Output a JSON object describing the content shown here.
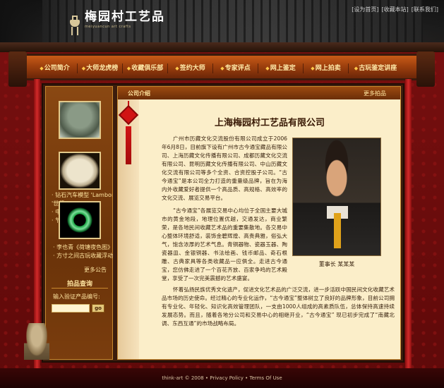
{
  "header": {
    "logo_text": "梅园村工艺品",
    "logo_subtitle": "meiyuancun art crafts",
    "top_links": [
      "[设为首页]",
      "[收藏本站]",
      "[联系我们]"
    ]
  },
  "nav": {
    "items": [
      "公司简介",
      "大师龙虎榜",
      "收藏俱乐部",
      "签约大师",
      "专家评点",
      "网上鉴定",
      "网上拍卖",
      "古玩鉴定讲座"
    ]
  },
  "sidebar": {
    "news_lines": [
      "· 钻石汽车模型 'Lamborghini Gallardo'",
      "'世纪...",
      "· 中...",
      "· 节..."
    ],
    "news_lines_2": [
      "· 李也青《荷塘夜色图》",
      "· 方寸之间古玩收藏浮动"
    ],
    "more": "更多公告",
    "auction_title": "拍品查询",
    "code_label": "输入验证产品编号:",
    "search_placeholder": "",
    "go_label": "go"
  },
  "main": {
    "section_title": "公司介绍",
    "more_link": "更多拍品",
    "company_name": "上海梅园村工艺品有限公司",
    "para1": "广州市历藏文化交流股份有限公司成立于2006年6月8日，目前旗下设有广州市古今通宝藏品有限公司、上海历藏文化传播有限公司、成都历藏文化交流有限公司、昆明历藏文化传播有限公司、中山历藏文化交流有限公司等多个全资、合资控股子公司。“古今通宝”是本公司全力打造的重量级品牌，旨在为海内外收藏爱好者提供一个高品质、高规格、高效率的文化交流、展览交易平台。",
    "para2": "“古今通宝”各展览交易中心均位于全国主要大城市的黄金地段，地理位置优越，交通发达，商业繁荣，是各地民间收藏艺术品的重要集散地。各交易中心整体环境舒适，装饰金碧辉煌、高贵典雅，俗弘大气，饱含浓厚的艺术气息。青铜器物、瓷器玉器、陶瓷器皿、金银铜器、书法绘画、钱币邮品、奇石根雕、古典家具等各类收藏品一应俱全。走进古今通宝，您仿佛走进了一个百花齐放、百家争鸣的艺术殿堂，享受了一次完美震撼的艺术盛宴。",
    "para3": "怀着弘扬民族优秀文化遗产，促进文化艺术品的广泛交流，进一步活跃中国民间文化收藏艺术品市场的历史使命。经过精心的专业化运作，“古今通宝”整体树立了良好的品牌形象，目前公司拥有专业化、年轻化、知识化高效管理团队，一支由1000人组成的高素质队伍，总体保持高速持续发展态势。而且，随着各地分公司和交易中心的相继开业，“古今通宝” 现已初步完成了“南藏北调、东西互通”的市场战略布局。",
    "photo_caption": "董事长  某某某"
  },
  "footer": {
    "text": "think-art © 2008 • Privacy Policy • Terms Of Use"
  }
}
